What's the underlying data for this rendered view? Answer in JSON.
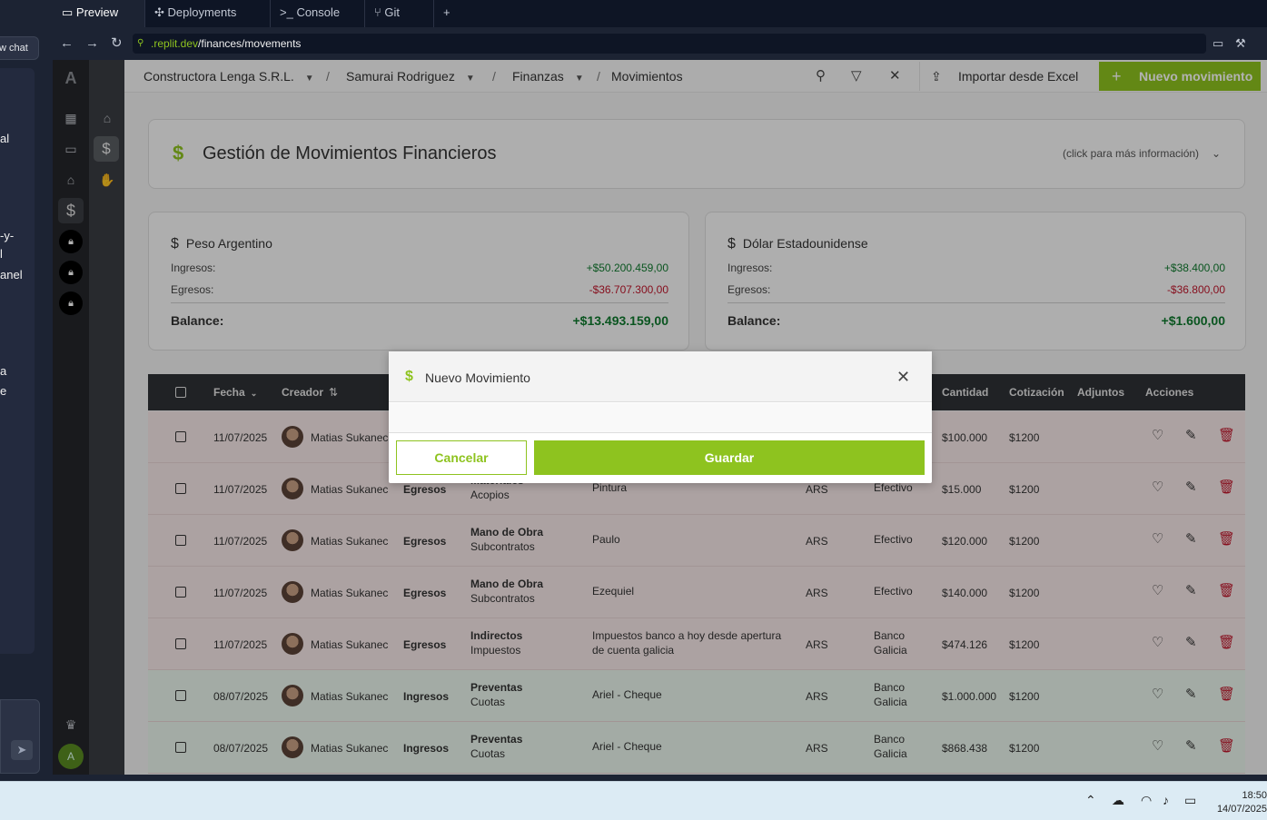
{
  "ide": {
    "chat_button": "w chat",
    "chat_fragments": [
      "al",
      "-y-",
      "l",
      "anel",
      "a",
      "e"
    ],
    "tabs": [
      "Preview",
      "Deployments",
      "Console",
      "Git",
      "+"
    ],
    "url_domain": ".replit.dev",
    "url_path": "/finances/movements"
  },
  "header": {
    "breadcrumbs": [
      "Constructora Lenga S.R.L.",
      "Samurai Rodriguez",
      "Finanzas",
      "Movimientos"
    ],
    "import_label": "Importar desde Excel",
    "new_label": "Nuevo movimiento"
  },
  "page": {
    "title": "Gestión de Movimientos Financieros",
    "info_hint": "(click para más información)"
  },
  "currencies": [
    {
      "name": "Peso Argentino",
      "income_label": "Ingresos:",
      "income": "+$50.200.459,00",
      "expense_label": "Egresos:",
      "expense": "-$36.707.300,00",
      "balance_label": "Balance:",
      "balance": "+$13.493.159,00"
    },
    {
      "name": "Dólar Estadounidense",
      "income_label": "Ingresos:",
      "income": "+$38.400,00",
      "expense_label": "Egresos:",
      "expense": "-$36.800,00",
      "balance_label": "Balance:",
      "balance": "+$1.600,00"
    }
  ],
  "table": {
    "headers": {
      "fecha": "Fecha",
      "creador": "Creador",
      "cantidad": "Cantidad",
      "cotizacion": "Cotización",
      "adjuntos": "Adjuntos",
      "acciones": "Acciones"
    },
    "rows": [
      {
        "date": "11/07/2025",
        "creator": "Matias Sukanec",
        "type": "",
        "cat1": "",
        "cat2": "",
        "desc": "",
        "currency": "",
        "method1": "",
        "method2": "",
        "amount": "$100.000",
        "rate": "$1200",
        "tone": "egreso"
      },
      {
        "date": "11/07/2025",
        "creator": "Matias Sukanec",
        "type": "Egresos",
        "cat1": "Materiales",
        "cat2": "Acopios",
        "desc": "Pintura",
        "currency": "ARS",
        "method1": "Efectivo",
        "method2": "",
        "amount": "$15.000",
        "rate": "$1200",
        "tone": "egreso"
      },
      {
        "date": "11/07/2025",
        "creator": "Matias Sukanec",
        "type": "Egresos",
        "cat1": "Mano de Obra",
        "cat2": "Subcontratos",
        "desc": "Paulo",
        "currency": "ARS",
        "method1": "Efectivo",
        "method2": "",
        "amount": "$120.000",
        "rate": "$1200",
        "tone": "egreso"
      },
      {
        "date": "11/07/2025",
        "creator": "Matias Sukanec",
        "type": "Egresos",
        "cat1": "Mano de Obra",
        "cat2": "Subcontratos",
        "desc": "Ezequiel",
        "currency": "ARS",
        "method1": "Efectivo",
        "method2": "",
        "amount": "$140.000",
        "rate": "$1200",
        "tone": "egreso"
      },
      {
        "date": "11/07/2025",
        "creator": "Matias Sukanec",
        "type": "Egresos",
        "cat1": "Indirectos",
        "cat2": "Impuestos",
        "desc": "Impuestos banco a hoy desde apertura",
        "desc2": "de cuenta galicia",
        "currency": "ARS",
        "method1": "Banco",
        "method2": "Galicia",
        "amount": "$474.126",
        "rate": "$1200",
        "tone": "egreso"
      },
      {
        "date": "08/07/2025",
        "creator": "Matias Sukanec",
        "type": "Ingresos",
        "cat1": "Preventas",
        "cat2": "Cuotas",
        "desc": "Ariel - Cheque",
        "currency": "ARS",
        "method1": "Banco",
        "method2": "Galicia",
        "amount": "$1.000.000",
        "rate": "$1200",
        "tone": "ingreso"
      },
      {
        "date": "08/07/2025",
        "creator": "Matias Sukanec",
        "type": "Ingresos",
        "cat1": "Preventas",
        "cat2": "Cuotas",
        "desc": "Ariel - Cheque",
        "currency": "ARS",
        "method1": "Banco",
        "method2": "Galicia",
        "amount": "$868.438",
        "rate": "$1200",
        "tone": "ingreso"
      }
    ]
  },
  "modal": {
    "title": "Nuevo Movimiento",
    "cancel": "Cancelar",
    "save": "Guardar"
  },
  "sidebar": {
    "logo": "A",
    "avatar": "A"
  },
  "taskbar": {
    "time": "18:50",
    "date": "14/07/2025"
  },
  "colors": {
    "accent": "#8ec31f",
    "income": "#0f7a2e",
    "expense": "#c0162b",
    "egreso_row": "#f7e9e9",
    "ingreso_row": "#eaf5ec"
  }
}
